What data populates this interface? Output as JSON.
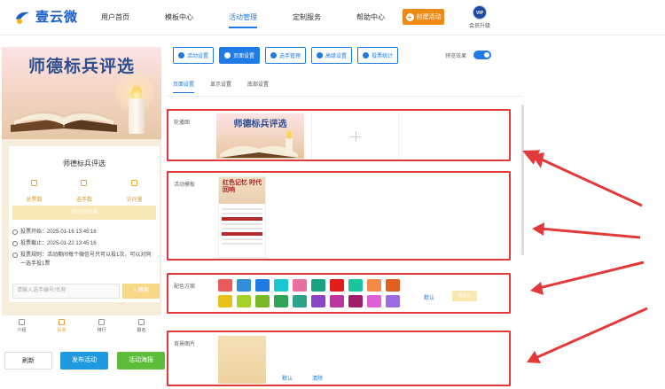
{
  "header": {
    "logo_text": "壹云微",
    "nav": [
      "用户首页",
      "模板中心",
      "活动管理",
      "定制服务",
      "帮助中心"
    ],
    "active_nav_index": 2,
    "create_label": "创建活动",
    "vip_badge": "VIP",
    "vip_label": "会员升级"
  },
  "preview": {
    "banner_title": "师德标兵评选",
    "card_title": "师德标兵评选",
    "stats": [
      {
        "label": "总票数",
        "value": ""
      },
      {
        "label": "选手数",
        "value": ""
      },
      {
        "label": "访问量",
        "value": ""
      }
    ],
    "rank_button": "活动已结束",
    "info": [
      "投票开始：2025-01-16 13:45:16",
      "投票截止：2025-01-22 13:45:16",
      "投票规则：活动期间每个微信号只可以投1次，可以对同一选手投1票"
    ],
    "search_placeholder": "请输入选手编号/名称",
    "search_button": "搜索",
    "tabs": [
      "介绍",
      "投票",
      "排行",
      "报名"
    ],
    "active_tab_index": 1,
    "buttons": {
      "refresh": "刷新",
      "publish": "发布活动",
      "poster": "活动海报"
    }
  },
  "toolbar": {
    "buttons": [
      "活动设置",
      "页面设置",
      "选手管理",
      "高级设置",
      "投票统计"
    ],
    "active_index": 1,
    "preview_label": "预览效果",
    "preview_on": true
  },
  "subtabs": [
    "页面设置",
    "显示设置",
    "底部设置"
  ],
  "active_subtab": 0,
  "sections": {
    "carousel": {
      "label": "轮播图",
      "image_title": "师德标兵评选"
    },
    "template": {
      "label": "活动模板",
      "template_title": "红色记忆 时代回响"
    },
    "colors": {
      "label": "配色方案",
      "row1": [
        "#ea5a5a",
        "#2f8fd8",
        "#1e7be6",
        "#19c6d4",
        "#ea6e9e",
        "#19a382",
        "#e21b1b",
        "#19c69e",
        "#f58a46",
        "#e05e1e"
      ],
      "row2": [
        "#e8c21b",
        "#a6d12a",
        "#7ab82a",
        "#2fa356",
        "#2fa38a",
        "#8a44c8",
        "#b8369e",
        "#9e1e6a",
        "#e05ed8",
        "#9e6ae0"
      ],
      "default_label": "默认",
      "custom_label": "自定义"
    },
    "background": {
      "label": "背景图片",
      "default_label": "默认",
      "clear_label": "清除"
    }
  },
  "colors": {
    "accent": "#1f7be6",
    "highlight_border": "#e23a3a",
    "orange": "#f08a16"
  }
}
